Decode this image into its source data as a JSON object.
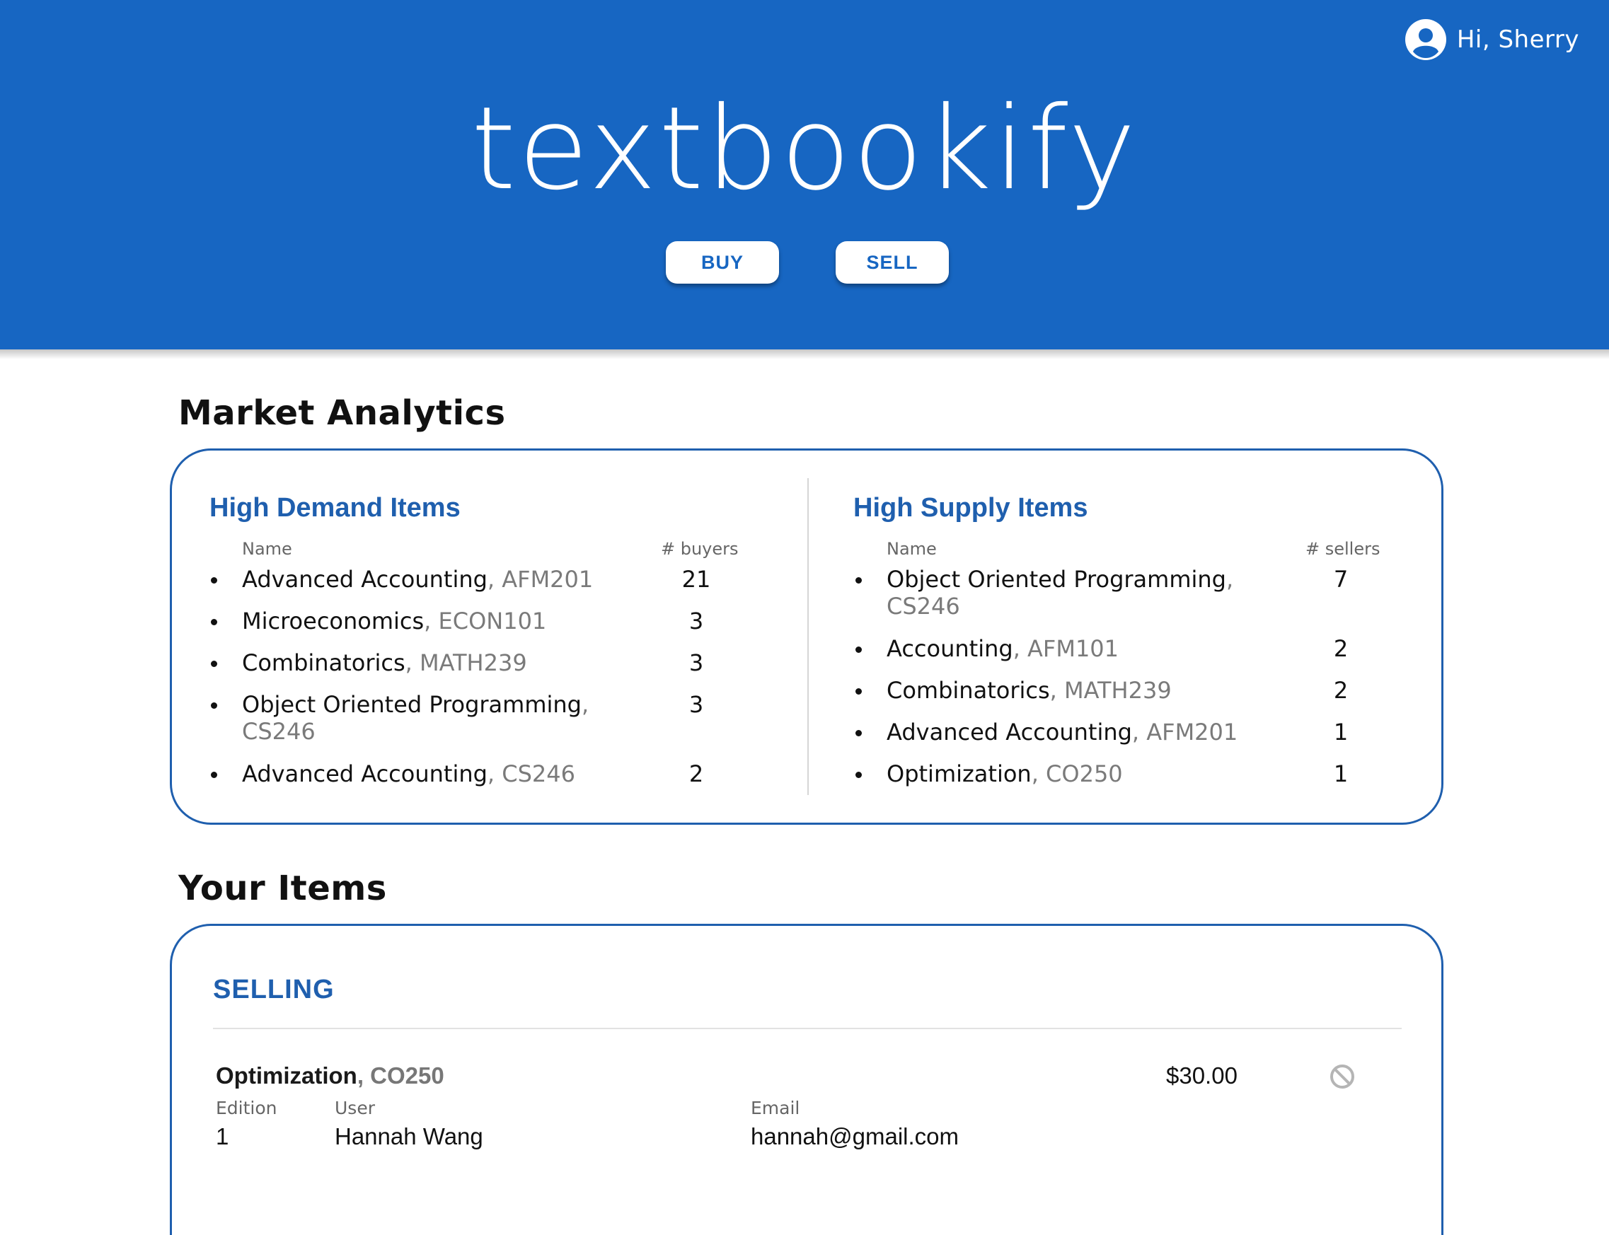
{
  "header": {
    "greeting": "Hi, Sherry",
    "user_icon": "account-circle-icon",
    "logo": "textbookify",
    "buy_label": "BUY",
    "sell_label": "SELL"
  },
  "analytics": {
    "title": "Market Analytics",
    "demand": {
      "title": "High Demand Items",
      "name_header": "Name",
      "count_header": "# buyers",
      "rows": [
        {
          "name": "Advanced Accounting",
          "code": "AFM201",
          "count": "21"
        },
        {
          "name": "Microeconomics",
          "code": "ECON101",
          "count": "3"
        },
        {
          "name": "Combinatorics",
          "code": "MATH239",
          "count": "3"
        },
        {
          "name": "Object Oriented Programming",
          "code": "CS246",
          "count": "3"
        },
        {
          "name": "Advanced Accounting",
          "code": "CS246",
          "count": "2"
        }
      ]
    },
    "supply": {
      "title": "High Supply Items",
      "name_header": "Name",
      "count_header": "# sellers",
      "rows": [
        {
          "name": "Object Oriented Programming",
          "code": "CS246",
          "count": "7"
        },
        {
          "name": "Accounting",
          "code": "AFM101",
          "count": "2"
        },
        {
          "name": "Combinatorics",
          "code": "MATH239",
          "count": "2"
        },
        {
          "name": "Advanced Accounting",
          "code": "AFM201",
          "count": "1"
        },
        {
          "name": "Optimization",
          "code": "CO250",
          "count": "1"
        }
      ]
    }
  },
  "your_items": {
    "title": "Your Items",
    "selling_title": "SELLING",
    "items": [
      {
        "name": "Optimization",
        "code": "CO250",
        "price": "$30.00",
        "edition_label": "Edition",
        "edition": "1",
        "user_label": "User",
        "user": "Hannah Wang",
        "email_label": "Email",
        "email": "hannah@gmail.com",
        "remove_icon": "prohibited-icon"
      }
    ]
  },
  "colors": {
    "brand_blue": "#1766c2",
    "heading_blue": "#1f5fae",
    "muted_gray": "#7a7a7a"
  }
}
